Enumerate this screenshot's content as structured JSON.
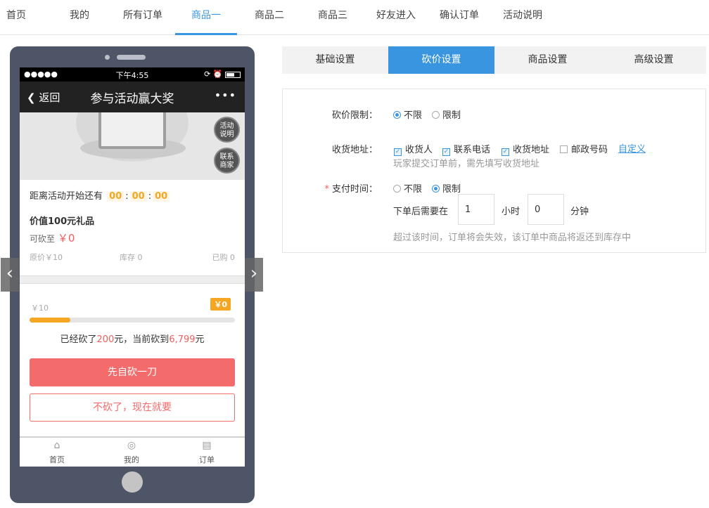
{
  "top_nav": {
    "tabs": [
      "首页",
      "我的",
      "所有订单",
      "商品一",
      "商品二",
      "商品三",
      "好友进入",
      "确认订单",
      "活动说明"
    ],
    "active_tab": "商品一",
    "accent_color": "#3a95e0"
  },
  "phone": {
    "status": {
      "signal": "●●●●●",
      "time": "下午4:55"
    },
    "nav": {
      "back_label": "返回",
      "title": "参与活动赢大奖",
      "more_icon": "•••"
    },
    "banner": {
      "rules_label": "活动\n说明",
      "contact_label": "联系\n商家"
    },
    "countdown": {
      "prefix": "距离活动开始还有",
      "hours": "00",
      "minutes": "00",
      "seconds": "00"
    },
    "product": {
      "name": "价值100元礼品",
      "bargain_to_label": "可砍至",
      "bargain_to_price": "￥0",
      "original_price": "原价￥10",
      "stock": "库存 0",
      "sold": "已购 0"
    },
    "progress": {
      "start_price": "￥10",
      "end_flag": "￥0",
      "fill_fraction": 0.2,
      "summary_a": "已经砍了",
      "summary_amount": "200",
      "summary_b": "元，当前砍到",
      "summary_current": "6,799",
      "summary_c": "元"
    },
    "buttons": {
      "primary": "先自砍一刀",
      "secondary": "不砍了，现在就要"
    },
    "tabbar": [
      {
        "label": "首页",
        "icon": "home-icon"
      },
      {
        "label": "我的",
        "icon": "user-icon"
      },
      {
        "label": "订单",
        "icon": "order-icon"
      }
    ]
  },
  "settings": {
    "tabs": [
      "基础设置",
      "砍价设置",
      "商品设置",
      "高级设置"
    ],
    "active_tab": "砍价设置",
    "bargain_limit": {
      "label": "砍价限制：",
      "options": [
        "不限",
        "限制"
      ],
      "selected": "不限"
    },
    "address": {
      "label": "收货地址：",
      "fields": [
        {
          "label": "收货人",
          "checked": true
        },
        {
          "label": "联系电话",
          "checked": true
        },
        {
          "label": "收货地址",
          "checked": true
        },
        {
          "label": "邮政号码",
          "checked": false
        }
      ],
      "custom_link": "自定义",
      "hint": "玩家提交订单前，需先填写收货地址"
    },
    "pay_time": {
      "required_mark": "*",
      "label": "支付时间：",
      "options": [
        "不限",
        "限制"
      ],
      "selected": "限制",
      "prefix": "下单后需要在",
      "hours_value": "1",
      "hours_unit": "小时",
      "minutes_value": "0",
      "minutes_unit": "分钟",
      "hint": "超过该时间，订单将会失效，该订单中商品将返还到库存中"
    }
  }
}
